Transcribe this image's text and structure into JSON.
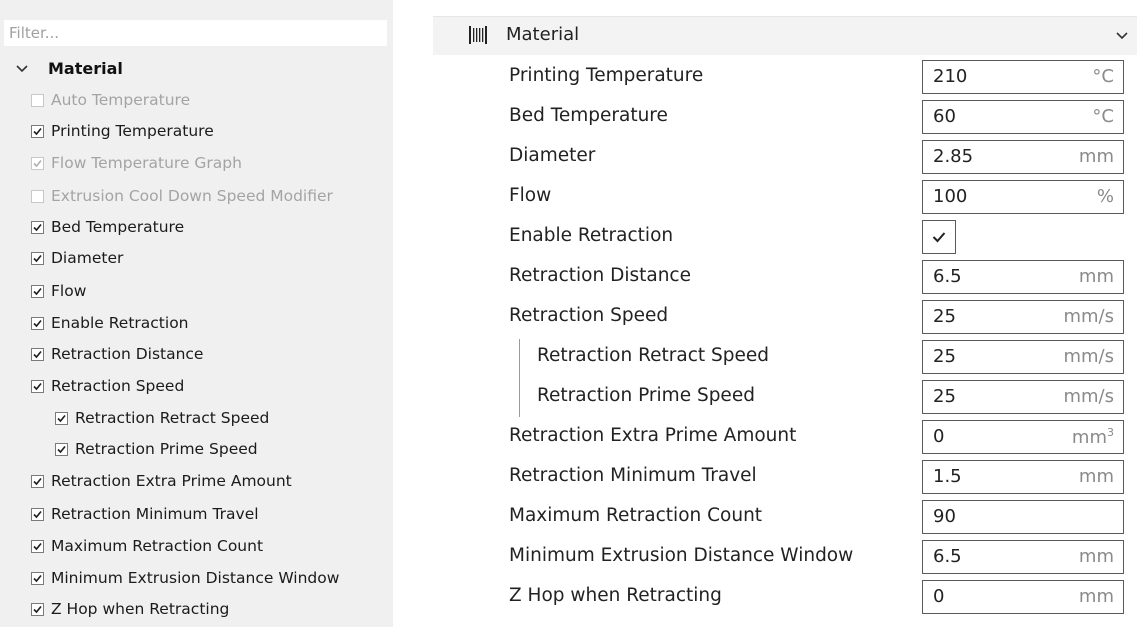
{
  "filter": {
    "placeholder": "Filter..."
  },
  "tree": {
    "header": "Material",
    "items": [
      {
        "label": "Auto Temperature",
        "state": "unchecked",
        "disabled": true
      },
      {
        "label": "Printing Temperature",
        "state": "checked",
        "disabled": false
      },
      {
        "label": "Flow Temperature Graph",
        "state": "checked",
        "disabled": true
      },
      {
        "label": "Extrusion Cool Down Speed Modifier",
        "state": "unchecked",
        "disabled": true
      },
      {
        "label": "Bed Temperature",
        "state": "checked",
        "disabled": false
      },
      {
        "label": "Diameter",
        "state": "checked",
        "disabled": false
      },
      {
        "label": "Flow",
        "state": "checked",
        "disabled": false
      },
      {
        "label": "Enable Retraction",
        "state": "checked",
        "disabled": false
      },
      {
        "label": "Retraction Distance",
        "state": "checked",
        "disabled": false
      },
      {
        "label": "Retraction Speed",
        "state": "checked",
        "disabled": false
      },
      {
        "label": "Retraction Retract Speed",
        "state": "checked",
        "disabled": false
      },
      {
        "label": "Retraction Prime Speed",
        "state": "checked",
        "disabled": false
      },
      {
        "label": "Retraction Extra Prime Amount",
        "state": "checked",
        "disabled": false
      },
      {
        "label": "Retraction Minimum Travel",
        "state": "checked",
        "disabled": false
      },
      {
        "label": "Maximum Retraction Count",
        "state": "checked",
        "disabled": false
      },
      {
        "label": "Minimum Extrusion Distance Window",
        "state": "checked",
        "disabled": false
      },
      {
        "label": "Z Hop when Retracting",
        "state": "checked",
        "disabled": false
      }
    ]
  },
  "section": {
    "title": "Material",
    "icon": "material-spool-icon"
  },
  "settings": [
    {
      "label": "Printing Temperature",
      "value": "210",
      "unit": "°C"
    },
    {
      "label": "Bed Temperature",
      "value": "60",
      "unit": "°C"
    },
    {
      "label": "Diameter",
      "value": "2.85",
      "unit": "mm"
    },
    {
      "label": "Flow",
      "value": "100",
      "unit": "%"
    },
    {
      "label": "Enable Retraction",
      "checked": true
    },
    {
      "label": "Retraction Distance",
      "value": "6.5",
      "unit": "mm"
    },
    {
      "label": "Retraction Speed",
      "value": "25",
      "unit": "mm/s"
    },
    {
      "label": "Retraction Retract Speed",
      "value": "25",
      "unit": "mm/s"
    },
    {
      "label": "Retraction Prime Speed",
      "value": "25",
      "unit": "mm/s"
    },
    {
      "label": "Retraction Extra Prime Amount",
      "value": "0",
      "unit": "mm",
      "unit_sup": "3"
    },
    {
      "label": "Retraction Minimum Travel",
      "value": "1.5",
      "unit": "mm"
    },
    {
      "label": "Maximum Retraction Count",
      "value": "90",
      "unit": ""
    },
    {
      "label": "Minimum Extrusion Distance Window",
      "value": "6.5",
      "unit": "mm"
    },
    {
      "label": "Z Hop when Retracting",
      "value": "0",
      "unit": "mm"
    }
  ]
}
